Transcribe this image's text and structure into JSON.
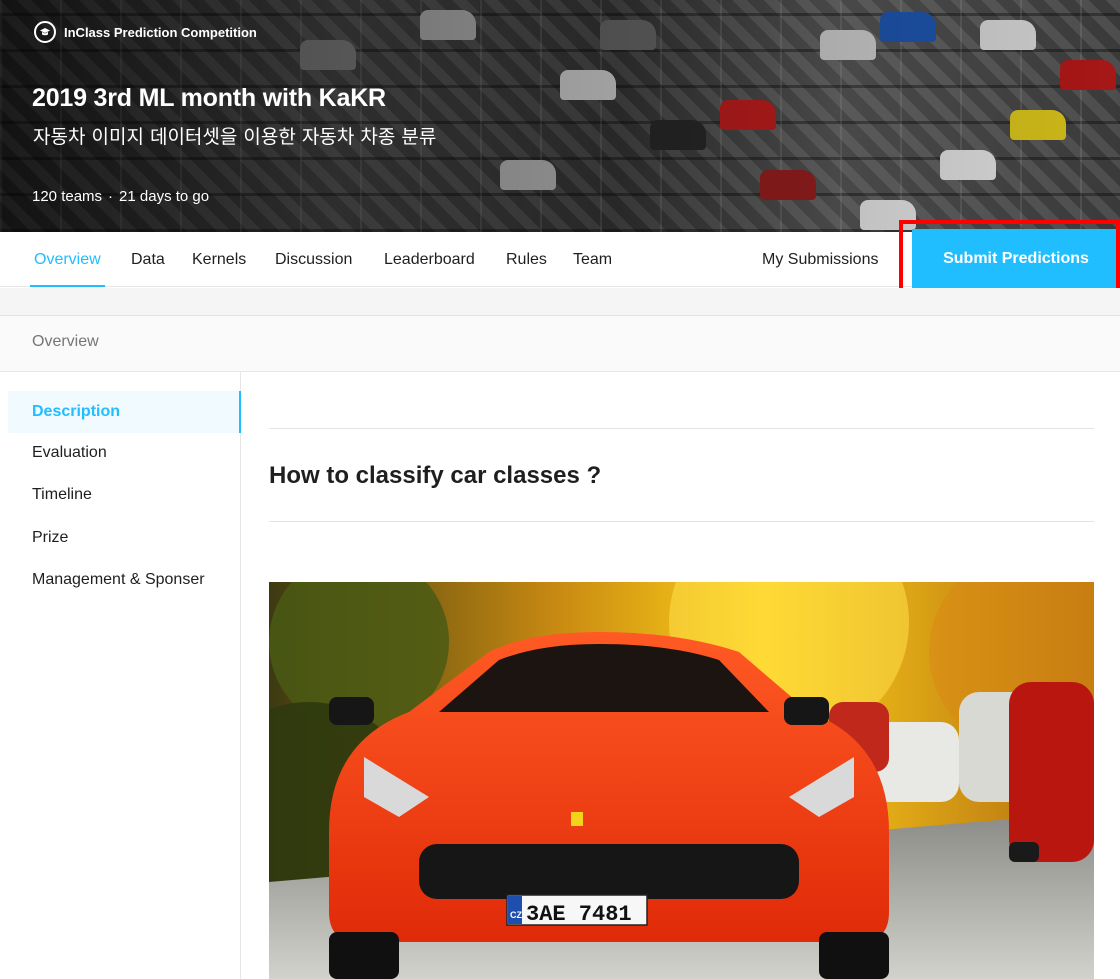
{
  "hero": {
    "competition_type": "InClass Prediction Competition",
    "title": "2019 3rd ML month with KaKR",
    "subtitle": "자동차 이미지 데이터셋을 이용한 자동차 차종 분류",
    "teams": "120 teams",
    "separator": "·",
    "time_left": "21 days to go"
  },
  "nav": {
    "tabs": [
      {
        "label": "Overview"
      },
      {
        "label": "Data"
      },
      {
        "label": "Kernels"
      },
      {
        "label": "Discussion"
      },
      {
        "label": "Leaderboard"
      },
      {
        "label": "Rules"
      },
      {
        "label": "Team"
      }
    ],
    "my_submissions": "My Submissions",
    "submit_label": "Submit Predictions"
  },
  "section": {
    "header": "Overview"
  },
  "sidebar": {
    "items": [
      {
        "label": "Description"
      },
      {
        "label": "Evaluation"
      },
      {
        "label": "Timeline"
      },
      {
        "label": "Prize"
      },
      {
        "label": "Management & Sponser"
      }
    ]
  },
  "main": {
    "heading": "How to classify car classes ?",
    "license_plate": "3AE 7481",
    "plate_country": "CZ"
  },
  "colors": {
    "accent": "#20beff",
    "highlight": "#ff0000",
    "car": "#ff3a14"
  },
  "icons": {
    "competition": "graduation-cap-icon"
  }
}
